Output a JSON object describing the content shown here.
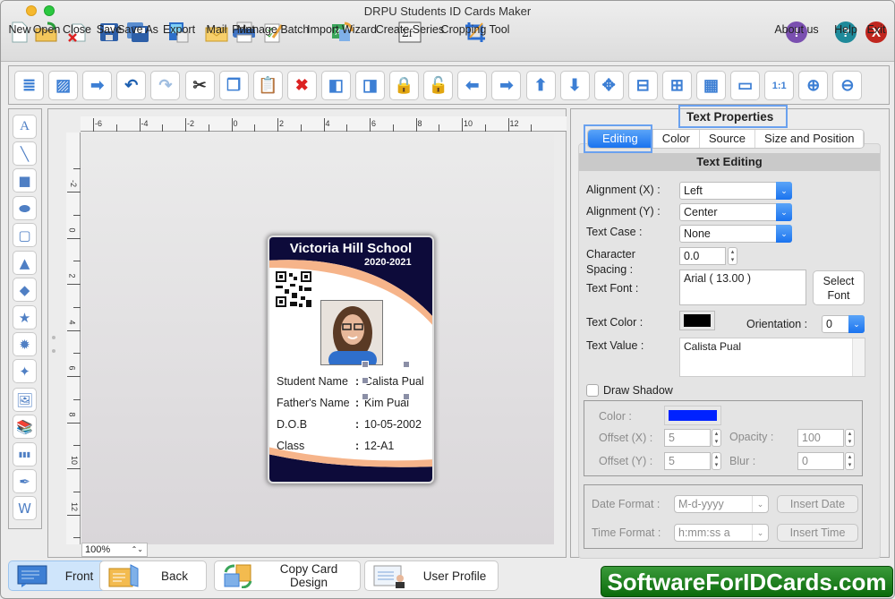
{
  "window": {
    "title": "DRPU Students ID Cards Maker"
  },
  "main_toolbar": [
    {
      "label": "New",
      "icon": "new-document-icon"
    },
    {
      "label": "Open",
      "icon": "open-folder-icon"
    },
    {
      "label": "Close",
      "icon": "close-document-icon"
    },
    {
      "label": "Save",
      "icon": "save-icon"
    },
    {
      "label": "Save As",
      "icon": "save-as-icon"
    },
    {
      "label": "Export",
      "icon": "export-icon"
    },
    {
      "label": "Mail",
      "icon": "mail-icon"
    },
    {
      "label": "Print",
      "icon": "print-icon"
    },
    {
      "label": "Manage Batch",
      "icon": "manage-batch-icon"
    },
    {
      "label": "Import Wizard",
      "icon": "import-wizard-icon"
    },
    {
      "label": "Create Series",
      "icon": "create-series-icon"
    },
    {
      "label": "Cropping Tool",
      "icon": "crop-icon"
    }
  ],
  "right_toolbar": [
    {
      "label": "About us",
      "icon": "about-icon",
      "glyph": "!",
      "color": "#7a4fb0"
    },
    {
      "label": "Help",
      "icon": "help-icon",
      "glyph": "?",
      "color": "#1f8a9a"
    },
    {
      "label": "Exit",
      "icon": "exit-icon",
      "glyph": "X",
      "color": "#c0261f"
    }
  ],
  "edit_toolbar": [
    "properties",
    "image-background",
    "export-image",
    "undo",
    "redo",
    "cut",
    "copy",
    "paste",
    "delete",
    "send-backward",
    "bring-forward",
    "lock",
    "unlock",
    "move-left",
    "move-right",
    "move-up",
    "move-down",
    "center",
    "align-vertical-center",
    "align-horizontal-center",
    "grid",
    "ruler",
    "actual-size",
    "zoom-in",
    "zoom-out"
  ],
  "drawing_tools": [
    "text",
    "line",
    "rectangle",
    "ellipse",
    "rounded-rectangle",
    "triangle",
    "diamond",
    "star",
    "burst",
    "four-point-star",
    "image",
    "library",
    "barcode",
    "signature",
    "watermark"
  ],
  "ruler": {
    "h_ticks": [
      "-6",
      "-4",
      "-2",
      "0",
      "2",
      "4",
      "6",
      "8",
      "10",
      "12"
    ],
    "v_ticks": [
      "-2",
      "0",
      "2",
      "4",
      "6",
      "8",
      "10",
      "12"
    ]
  },
  "zoom_level": "100%",
  "card": {
    "school": "Victoria Hill School",
    "year": "2020-2021",
    "fields": [
      {
        "label": "Student Name",
        "value": "Calista Pual"
      },
      {
        "label": "Father's Name",
        "value": "Kim Pual"
      },
      {
        "label": "D.O.B",
        "value": "10-05-2002"
      },
      {
        "label": "Class",
        "value": "12-A1"
      }
    ],
    "colors": {
      "navy": "#0d0b3a",
      "peach": "#f6b48a"
    }
  },
  "properties": {
    "title": "Text Properties",
    "tabs": [
      "Editing",
      "Color",
      "Source",
      "Size and Position"
    ],
    "active_tab": "Editing",
    "section_title": "Text Editing",
    "alignment_x_label": "Alignment (X) :",
    "alignment_x": "Left",
    "alignment_y_label": "Alignment (Y) :",
    "alignment_y": "Center",
    "text_case_label": "Text Case :",
    "text_case": "None",
    "char_spacing_label_1": "Character",
    "char_spacing_label_2": "Spacing :",
    "char_spacing": "0.0",
    "text_font_label": "Text Font :",
    "text_font": "Arial ( 13.00 )",
    "select_font_1": "Select",
    "select_font_2": "Font",
    "text_color_label": "Text Color :",
    "text_color": "#000000",
    "orientation_label": "Orientation :",
    "orientation": "0",
    "text_value_label": "Text Value :",
    "text_value": "Calista Pual",
    "draw_shadow_label": "Draw Shadow",
    "draw_shadow": false,
    "shadow": {
      "color_label": "Color :",
      "color": "#0022ff",
      "offset_x_label": "Offset (X) :",
      "offset_x": "5",
      "offset_y_label": "Offset (Y) :",
      "offset_y": "5",
      "opacity_label": "Opacity :",
      "opacity": "100",
      "blur_label": "Blur :",
      "blur": "0"
    },
    "date_format_label": "Date Format :",
    "date_format": "M-d-yyyy",
    "insert_date": "Insert Date",
    "time_format_label": "Time Format :",
    "time_format": "h:mm:ss a",
    "insert_time": "Insert Time"
  },
  "bottom_buttons": [
    {
      "label": "Front",
      "active": true
    },
    {
      "label": "Back",
      "active": false
    },
    {
      "label": "Copy Card Design",
      "active": false
    },
    {
      "label": "User Profile",
      "active": false
    }
  ],
  "brand": "SoftwareForIDCards.com"
}
